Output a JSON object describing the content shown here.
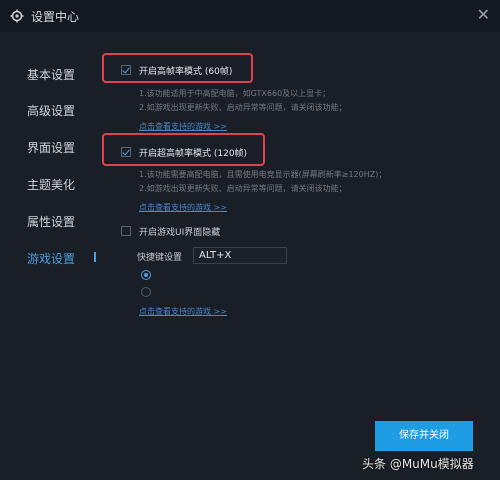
{
  "window": {
    "title": "设置中心",
    "close_icon": "close-icon",
    "settings_icon": "gear-icon"
  },
  "sidebar": {
    "items": [
      {
        "label": "基本设置",
        "active": false
      },
      {
        "label": "高级设置",
        "active": false
      },
      {
        "label": "界面设置",
        "active": false
      },
      {
        "label": "主题美化",
        "active": false
      },
      {
        "label": "属性设置",
        "active": false
      },
      {
        "label": "游戏设置",
        "active": true
      }
    ]
  },
  "options": {
    "fps60": {
      "label": "开启高帧率模式 (60帧)",
      "checked": true,
      "desc1": "1.该功能适用于中高配电脑，如GTX660及以上显卡；",
      "desc2": "2.如游戏出现更新失败、启动异常等问题，请关闭该功能；",
      "link": "点击查看支持的游戏 >>"
    },
    "fps120": {
      "label": "开启超高帧率模式 (120帧)",
      "checked": true,
      "desc1": "1.该功能需要高配电脑，且需使用电竞显示器(屏幕刷新率≥120HZ)；",
      "desc2": "2.如游戏出现更新失败、启动异常等问题，请关闭该功能；",
      "link": "点击查看支持的游戏 >>"
    },
    "ui_hide": {
      "label": "开启游戏UI界面隐藏",
      "checked": false,
      "shortcut_label": "快捷键设置",
      "shortcut_value": "ALT+X",
      "radio1": "",
      "radio2": "",
      "link": "点击查看支持的游戏 >>"
    }
  },
  "footer": {
    "save_label": "保存并关闭"
  },
  "watermark": {
    "text": "头条 @MuMu模拟器"
  },
  "colors": {
    "accent": "#1f9de4",
    "highlight": "#e0424f",
    "background": "#1a1e26"
  }
}
